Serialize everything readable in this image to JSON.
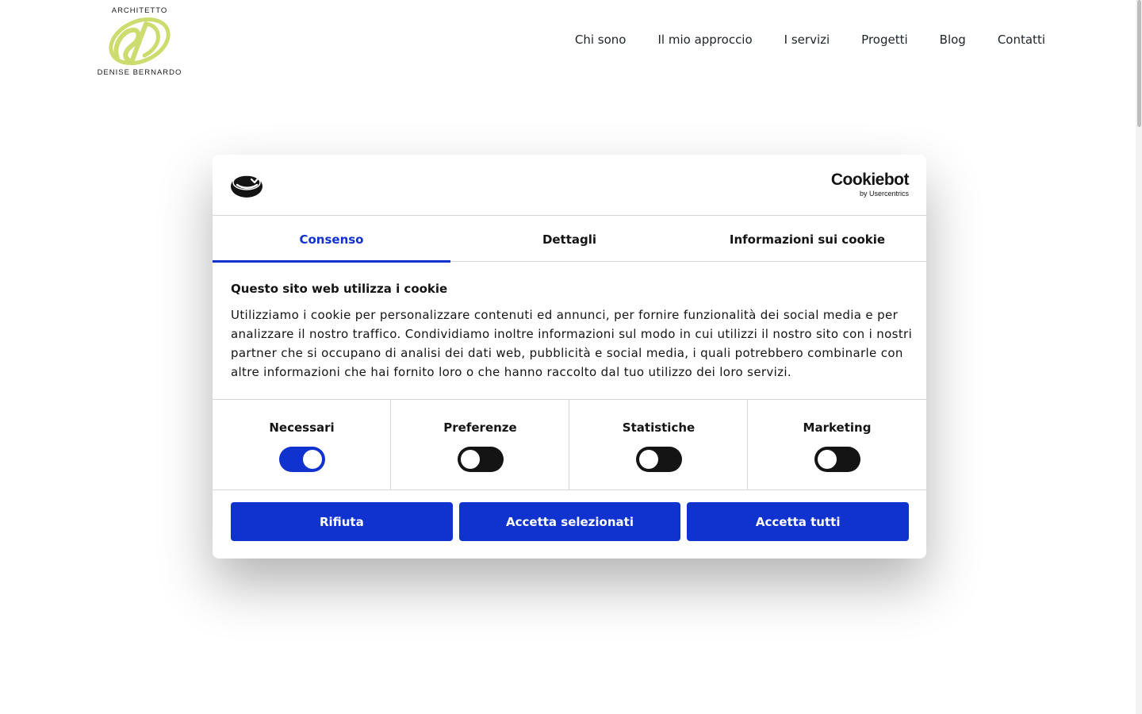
{
  "site": {
    "logo": {
      "top_text": "ARCHITETTO",
      "bottom_text": "DENISE BERNARDO",
      "accent_color": "#cddc6e"
    },
    "nav": [
      "Chi sono",
      "Il mio approccio",
      "I servizi",
      "Progetti",
      "Blog",
      "Contatti"
    ]
  },
  "cookie_dialog": {
    "brand": {
      "name": "Cookiebot",
      "sub": "by Usercentrics"
    },
    "tabs": [
      {
        "label": "Consenso",
        "active": true
      },
      {
        "label": "Dettagli",
        "active": false
      },
      {
        "label": "Informazioni sui cookie",
        "active": false
      }
    ],
    "title": "Questo sito web utilizza i cookie",
    "body": "Utilizziamo i cookie per personalizzare contenuti ed annunci, per fornire funzionalità dei social media e per analizzare il nostro traffico. Condividiamo inoltre informazioni sul modo in cui utilizzi il nostro sito con i nostri partner che si occupano di analisi dei dati web, pubblicità e social media, i quali potrebbero combinarle con altre informazioni che hai fornito loro o che hanno raccolto dal tuo utilizzo dei loro servizi.",
    "categories": [
      {
        "label": "Necessari",
        "enabled": true
      },
      {
        "label": "Preferenze",
        "enabled": false
      },
      {
        "label": "Statistiche",
        "enabled": false
      },
      {
        "label": "Marketing",
        "enabled": false
      }
    ],
    "buttons": {
      "reject": "Rifiuta",
      "accept_selected": "Accetta selezionati",
      "accept_all": "Accetta tutti"
    },
    "colors": {
      "accent": "#1032cf",
      "switch_off": "#141414"
    }
  }
}
